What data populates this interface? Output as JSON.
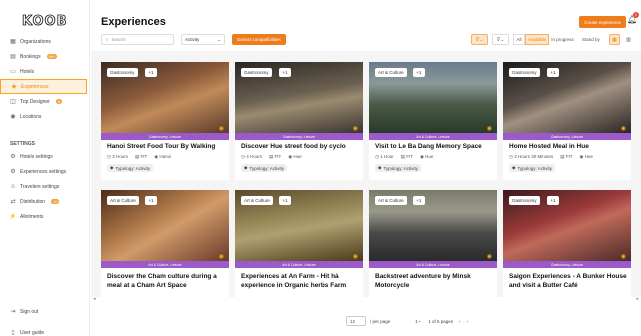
{
  "app": {
    "logo": "KOOB"
  },
  "sidebar": {
    "items": [
      {
        "label": "Organizations",
        "icon": "building-icon"
      },
      {
        "label": "Bookings",
        "icon": "calendar-icon",
        "badge": "99+"
      },
      {
        "label": "Hotels",
        "icon": "bed-icon"
      },
      {
        "label": "Experiences",
        "icon": "ticket-icon",
        "active": true
      },
      {
        "label": "Trip Designer",
        "icon": "map-icon",
        "badge": "8"
      },
      {
        "label": "Locations",
        "icon": "pin-icon"
      }
    ],
    "settings_title": "SETTINGS",
    "settings_items": [
      {
        "label": "Hotels settings",
        "icon": "gear-icon"
      },
      {
        "label": "Experiences settings",
        "icon": "gear-icon"
      },
      {
        "label": "Travelers settings",
        "icon": "users-icon"
      },
      {
        "label": "Distribution",
        "icon": "share-icon",
        "badge": "10"
      },
      {
        "label": "Allotments",
        "icon": "bolt-icon"
      }
    ],
    "bottom_items": [
      {
        "label": "Sign out",
        "icon": "logout-icon"
      },
      {
        "label": "User guide",
        "icon": "book-icon"
      }
    ]
  },
  "header": {
    "title": "Experiences",
    "create_label": "Create experience",
    "notification_count": "1"
  },
  "toolbar": {
    "search_placeholder": "Search",
    "select_value": "Activity",
    "extract_label": "Extract compatibilities",
    "status": {
      "all": "All",
      "available": "Available",
      "in_progress": "In progress",
      "stand_by": "Stand by"
    }
  },
  "cards": [
    {
      "title": "Hanoi Street Food Tour By Walking",
      "tag": "Gastronomy",
      "count": "+1",
      "categories": "Gastronomy, Leisure",
      "duration": "3 Hours",
      "type": "FIT",
      "city": "Hanoi",
      "typology": "Typology: Activity",
      "photo_color": "#7a4a3a"
    },
    {
      "title": "Discover Hue street food by cyclo",
      "tag": "Gastronomy",
      "count": "+1",
      "categories": "Gastronomy, Leisure",
      "duration": "4 Hours",
      "type": "FIT",
      "city": "Hue",
      "typology": "Typology: Activity",
      "photo_color": "#5a5245"
    },
    {
      "title": "Visit to Le Ba Dang Memory Space",
      "tag": "Art & Culture",
      "count": "+1",
      "categories": "Art & Culture, Leisure",
      "duration": "1 Hour",
      "type": "FIT",
      "city": "Hue",
      "typology": "Typology: Activity",
      "photo_color": "#6f7e6a"
    },
    {
      "title": "Home Hosted Meal in Hue",
      "tag": "Gastronomy",
      "count": "+1",
      "categories": "Gastronomy, Leisure",
      "duration": "2 Hours 30 Minutes",
      "type": "FIT",
      "city": "Hue",
      "typology": "Typology: Activity",
      "photo_color": "#4a4038"
    },
    {
      "title": "Discover the Cham culture during a meal at a Cham Art Space",
      "tag": "Art & Culture",
      "count": "+1",
      "categories": "Art & Culture, Leisure",
      "photo_color": "#8a5a3a"
    },
    {
      "title": "Experiences at An Farm - Hit hà experience in Organic herbs Farm",
      "tag": "Art & Culture",
      "count": "+1",
      "categories": "Art & Culture, Leisure",
      "photo_color": "#6a5a3a"
    },
    {
      "title": "Backstreet adventure by Minsk Motorcycle",
      "tag": "Art & Culture",
      "count": "+1",
      "categories": "Art & Culture, Leisure",
      "photo_color": "#5a5a5a"
    },
    {
      "title": "Saigon Experiences - A Bunker House and visit a Butter Café",
      "tag": "Gastronomy",
      "count": "+1",
      "categories": "Gastronomy, Leisure",
      "photo_color": "#7a3a3a"
    }
  ],
  "pagination": {
    "per_page_value": "12",
    "per_page_label": "/ per page",
    "page_value": "1",
    "page_info": "1 of 6 pages"
  }
}
